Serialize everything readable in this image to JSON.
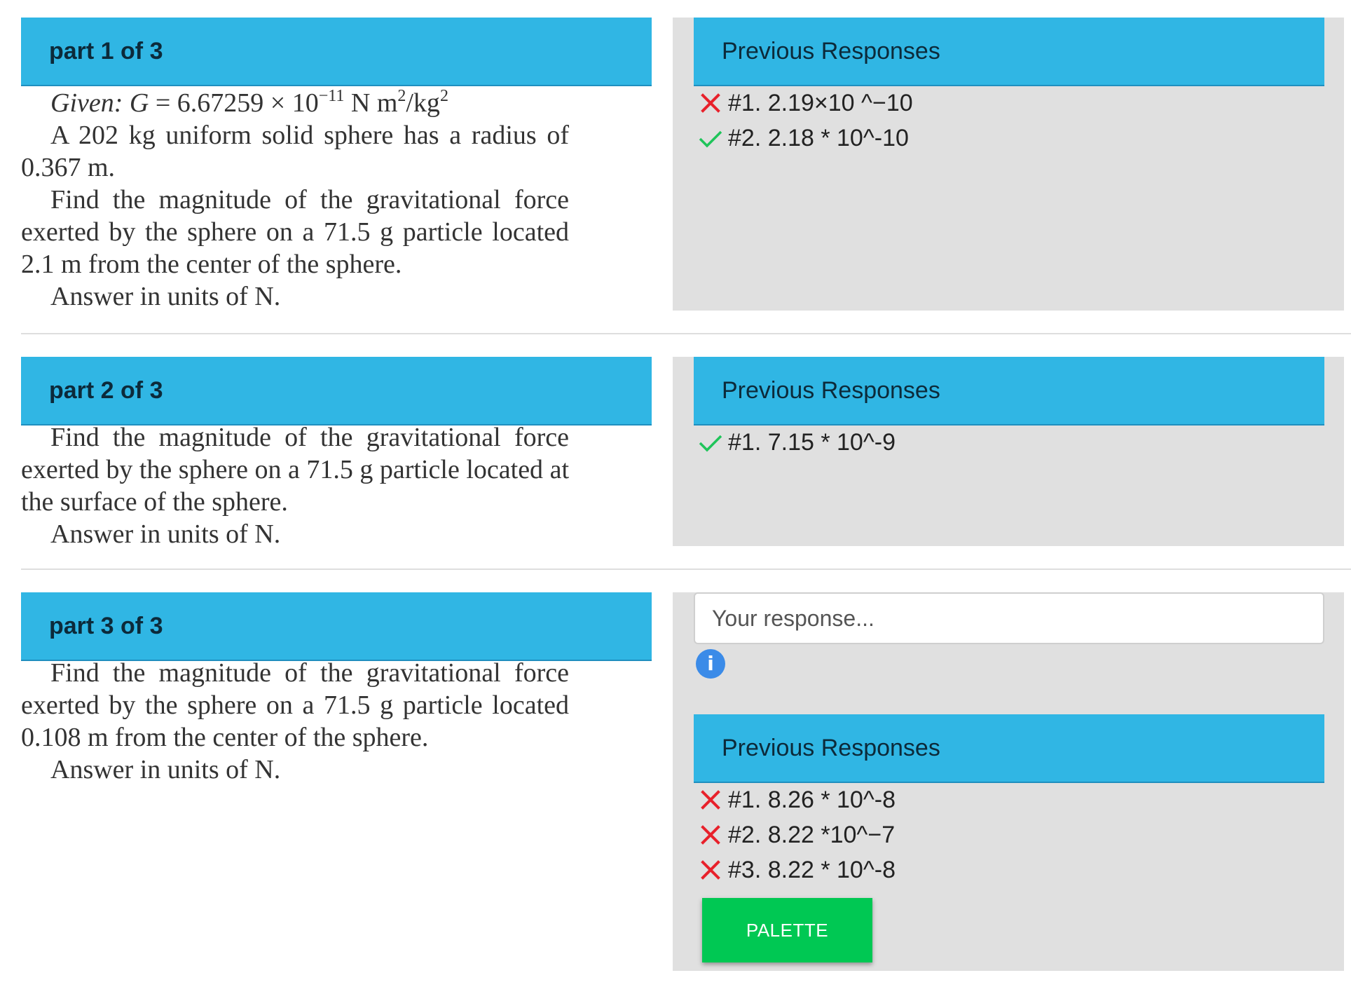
{
  "parts": [
    {
      "header": "part 1 of 3",
      "given": {
        "label": "Given:",
        "eq_G": "G",
        "eq_mid": " = 6.67259 × 10",
        "exp": "−11",
        "unit_a": " N m",
        "unit_sq1": "2",
        "unit_b": "/kg",
        "unit_sq2": "2"
      },
      "lines": [
        "A 202 kg uniform solid sphere has a radius of 0.367 m.",
        "Find the magnitude of the gravitational force exerted by the sphere on a 71.5 g particle located 2.1 m from the center of the sphere.",
        "Answer in units of  N."
      ],
      "previous_title": "Previous Responses",
      "responses": [
        {
          "status": "incorrect",
          "text": "#1. 2.19×10 ^−10"
        },
        {
          "status": "correct",
          "text": "#2. 2.18 * 10^-10"
        }
      ]
    },
    {
      "header": "part 2 of 3",
      "lines": [
        "Find the magnitude of the gravitational force exerted by the sphere on a 71.5 g particle located at the surface of the sphere.",
        "Answer in units of  N."
      ],
      "previous_title": "Previous Responses",
      "responses": [
        {
          "status": "correct",
          "text": "#1. 7.15 * 10^-9"
        }
      ]
    },
    {
      "header": "part 3 of 3",
      "lines": [
        "Find the magnitude of the gravitational force exerted by the sphere on a 71.5 g particle located 0.108 m from the center of the sphere.",
        "Answer in units of  N."
      ],
      "input_placeholder": "Your response...",
      "info_glyph": "i",
      "previous_title": "Previous Responses",
      "responses": [
        {
          "status": "incorrect",
          "text": "#1. 8.26 * 10^-8"
        },
        {
          "status": "incorrect",
          "text": "#2. 8.22 *10^−7"
        },
        {
          "status": "incorrect",
          "text": "#3. 8.22 * 10^-8"
        }
      ],
      "palette_label": "PALETTE"
    }
  ],
  "colors": {
    "header_blue": "#30b6e4",
    "panel_grey": "#e0e0e0",
    "correct_green": "#1fc45a",
    "incorrect_red": "#e8212b",
    "palette_green": "#00c853",
    "info_blue": "#3b8be8"
  },
  "icons": {
    "correct": "check-icon",
    "incorrect": "x-icon",
    "info": "info-icon"
  }
}
